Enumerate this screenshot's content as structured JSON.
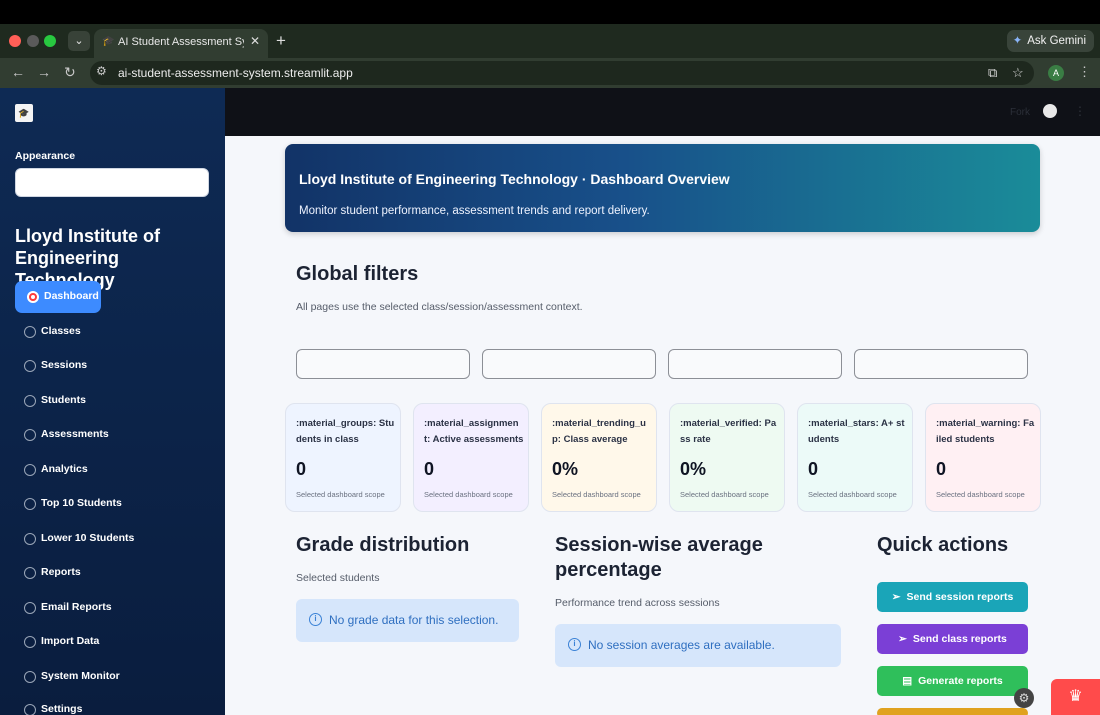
{
  "browser": {
    "tab_title": "AI Student Assessment System",
    "new_tab": "+",
    "close": "✕",
    "url": "ai-student-assessment-system.streamlit.app",
    "gemini_label": "Ask Gemini",
    "profile_initial": "A"
  },
  "app_header": {
    "fork_label": "Fork"
  },
  "sidebar": {
    "appearance_label": "Appearance",
    "institution": "Lloyd Institute of Engineering Technology",
    "nav": [
      {
        "label": "Dashboard",
        "active": true
      },
      {
        "label": "Classes"
      },
      {
        "label": "Sessions"
      },
      {
        "label": "Students"
      },
      {
        "label": "Assessments"
      },
      {
        "label": "Analytics"
      },
      {
        "label": "Top 10 Students"
      },
      {
        "label": "Lower 10 Students"
      },
      {
        "label": "Reports"
      },
      {
        "label": "Email Reports"
      },
      {
        "label": "Import Data"
      },
      {
        "label": "System Monitor"
      },
      {
        "label": "Settings"
      }
    ]
  },
  "hero": {
    "title": "Lloyd Institute of Engineering Technology · Dashboard Overview",
    "subtitle": "Monitor student performance, assessment trends and report delivery."
  },
  "global_filters": {
    "title": "Global filters",
    "subtitle": "All pages use the selected class/session/assessment context."
  },
  "metrics": [
    {
      "label": ":material_groups: Students in class",
      "value": "0",
      "scope": "Selected dashboard scope",
      "bg": "#eef4ff"
    },
    {
      "label": ":material_assignment: Active assessments",
      "value": "0",
      "scope": "Selected dashboard scope",
      "bg": "#f3efff"
    },
    {
      "label": ":material_trending_up: Class average",
      "value": "0%",
      "scope": "Selected dashboard scope",
      "bg": "#fff8ea"
    },
    {
      "label": ":material_verified: Pass rate",
      "value": "0%",
      "scope": "Selected dashboard scope",
      "bg": "#eefaf2"
    },
    {
      "label": ":material_stars: A+ students",
      "value": "0",
      "scope": "Selected dashboard scope",
      "bg": "#ecfaf8"
    },
    {
      "label": ":material_warning: Failed students",
      "value": "0",
      "scope": "Selected dashboard scope",
      "bg": "#fff0f3"
    }
  ],
  "grade_distribution": {
    "title": "Grade distribution",
    "subtitle": "Selected students",
    "info": "No grade data for this selection."
  },
  "session_average": {
    "title": "Session-wise average percentage",
    "subtitle": "Performance trend across sessions",
    "info": "No session averages are available."
  },
  "quick_actions": {
    "title": "Quick actions",
    "buttons": [
      {
        "label": "Send session reports",
        "icon": "send-icon",
        "color": "#1aa5b8"
      },
      {
        "label": "Send class reports",
        "icon": "send-icon",
        "color": "#7b3fd6"
      },
      {
        "label": "Generate reports",
        "icon": "document-icon",
        "color": "#2fbf5b"
      }
    ]
  }
}
